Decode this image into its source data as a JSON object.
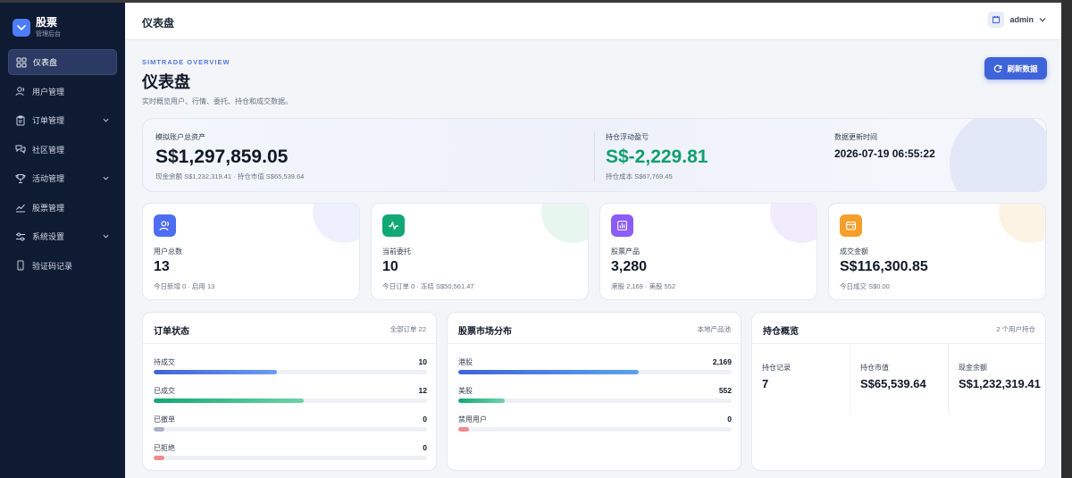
{
  "brand": {
    "title": "股票",
    "subtitle": "管理后台"
  },
  "sidebar": {
    "items": [
      {
        "label": "仪表盘",
        "icon": "dashboard-icon",
        "active": true
      },
      {
        "label": "用户管理",
        "icon": "users-icon"
      },
      {
        "label": "订单管理",
        "icon": "clipboard-icon",
        "expandable": true
      },
      {
        "label": "社区管理",
        "icon": "chat-icon"
      },
      {
        "label": "活动管理",
        "icon": "trophy-icon",
        "expandable": true
      },
      {
        "label": "股票管理",
        "icon": "chart-icon"
      },
      {
        "label": "系统设置",
        "icon": "sliders-icon",
        "expandable": true
      },
      {
        "label": "验证码记录",
        "icon": "phone-icon"
      }
    ]
  },
  "header": {
    "title": "仪表盘",
    "user": "admin"
  },
  "page": {
    "overline": "SIMTRADE OVERVIEW",
    "title": "仪表盘",
    "description": "实时概览用户、行情、委托、持仓和成交数据。",
    "refresh_label": "刷新数据"
  },
  "hero": {
    "total_label": "模拟账户总资产",
    "total_value": "S$1,297,859.05",
    "total_sub": "现金余额 S$1,232,319.41 · 持仓市值 S$65,539.64",
    "pnl_label": "持仓浮动盈亏",
    "pnl_value": "S$-2,229.81",
    "pnl_sub": "持仓成本 S$67,769.45",
    "time_label": "数据更新时间",
    "time_value": "2026-07-19 06:55:22"
  },
  "stats": [
    {
      "label": "用户总数",
      "value": "13",
      "sub": "今日新增 0 · 启用 13",
      "icon": "users-icon",
      "color": "#4d6ef2",
      "blob": "#eef1fd"
    },
    {
      "label": "当前委托",
      "value": "10",
      "sub": "今日订单 0 · 冻结 S$50,561.47",
      "icon": "activity-icon",
      "color": "#12a874",
      "blob": "#e7f6ef"
    },
    {
      "label": "股票产品",
      "value": "3,280",
      "sub": "港股 2,169 · 美股 552",
      "icon": "bar-chart-icon",
      "color": "#8b5cf6",
      "blob": "#f1ecfd"
    },
    {
      "label": "成交金额",
      "value": "S$116,300.85",
      "sub": "今日成交 S$0.00",
      "icon": "wallet-icon",
      "color": "#f59e2b",
      "blob": "#fdf3e5"
    }
  ],
  "order_status": {
    "title": "订单状态",
    "meta": "全部订单 22",
    "rows": [
      {
        "label": "待成交",
        "value": "10",
        "fraction": 0.45,
        "color": "linear-gradient(90deg,#3f63d8,#6b9cf5)"
      },
      {
        "label": "已成交",
        "value": "12",
        "fraction": 0.55,
        "color": "linear-gradient(90deg,#12a874,#6fd3a9)"
      },
      {
        "label": "已撤单",
        "value": "0",
        "fraction": 0.04,
        "color": "#aab2c4"
      },
      {
        "label": "已拒绝",
        "value": "0",
        "fraction": 0.04,
        "color": "#f08a8a"
      }
    ]
  },
  "market_dist": {
    "title": "股票市场分布",
    "meta": "本地产品池",
    "rows": [
      {
        "label": "港股",
        "value": "2,169",
        "fraction": 0.66,
        "color": "linear-gradient(90deg,#3f63d8,#5aa2f2)"
      },
      {
        "label": "美股",
        "value": "552",
        "fraction": 0.17,
        "color": "linear-gradient(90deg,#12a874,#6fd3a9)"
      },
      {
        "label": "禁用用户",
        "value": "0",
        "fraction": 0.04,
        "color": "#f08a8a"
      }
    ]
  },
  "holdings": {
    "title": "持仓概览",
    "meta": "2 个用户持仓",
    "cells": [
      {
        "label": "持仓记录",
        "value": "7"
      },
      {
        "label": "持仓市值",
        "value": "S$65,539.64"
      },
      {
        "label": "现金余额",
        "value": "S$1,232,319.41"
      }
    ]
  }
}
